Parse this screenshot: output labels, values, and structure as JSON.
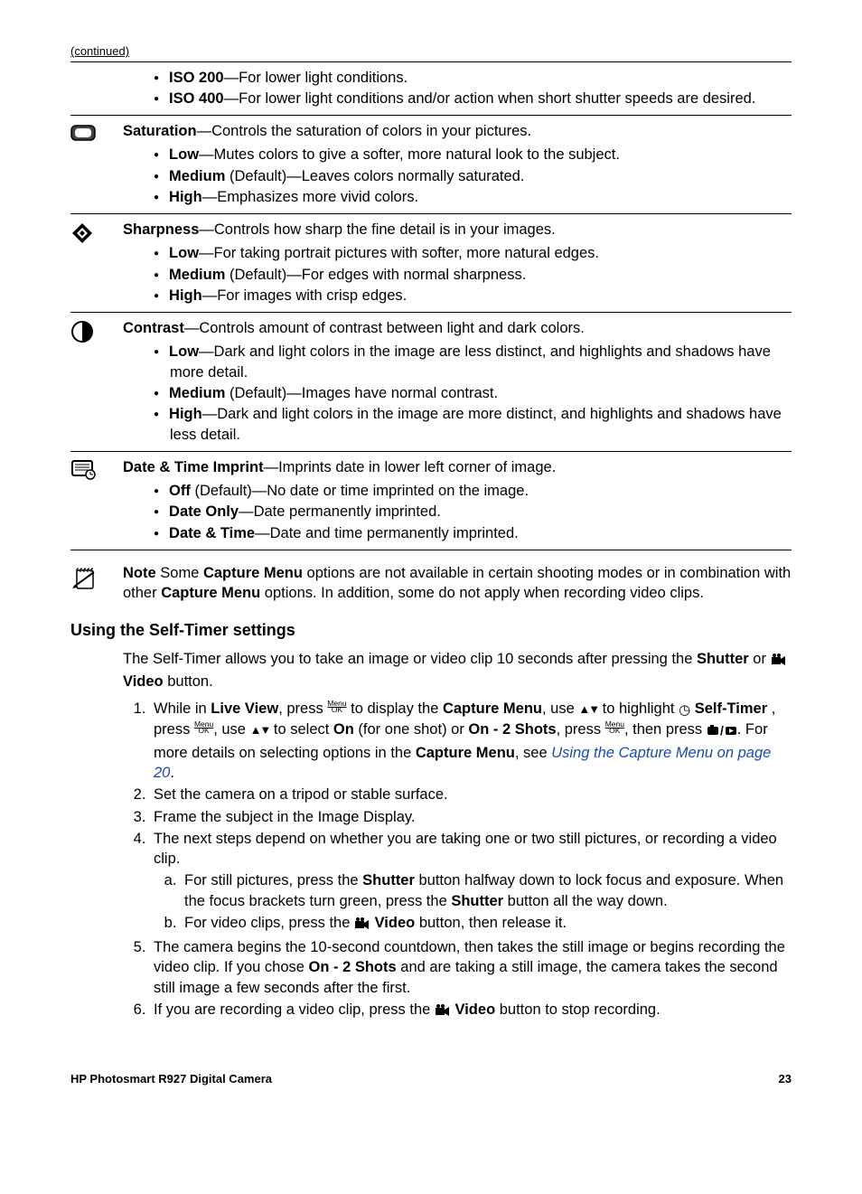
{
  "continued": "(continued)",
  "row_iso": {
    "items": [
      {
        "b1": "ISO 200",
        "t1": "—For lower light conditions."
      },
      {
        "b1": "ISO 400",
        "t1": "—For lower light conditions and/or action when short shutter speeds are desired."
      }
    ]
  },
  "row_saturation": {
    "intro_b": "Saturation",
    "intro_t": "—Controls the saturation of colors in your pictures.",
    "items": [
      {
        "b1": "Low",
        "t1": "—Mutes colors to give a softer, more natural look to the subject."
      },
      {
        "b1": "Medium",
        "t1": " (Default)—Leaves colors normally saturated."
      },
      {
        "b1": "High",
        "t1": "—Emphasizes more vivid colors."
      }
    ]
  },
  "row_sharpness": {
    "intro_b": "Sharpness",
    "intro_t": "—Controls how sharp the fine detail is in your images.",
    "items": [
      {
        "b1": "Low",
        "t1": "—For taking portrait pictures with softer, more natural edges."
      },
      {
        "b1": "Medium",
        "t1": " (Default)—For edges with normal sharpness."
      },
      {
        "b1": "High",
        "t1": "—For images with crisp edges."
      }
    ]
  },
  "row_contrast": {
    "intro_b": "Contrast",
    "intro_t": "—Controls amount of contrast between light and dark colors.",
    "items": [
      {
        "b1": "Low",
        "t1": "—Dark and light colors in the image are less distinct, and highlights and shadows have more detail."
      },
      {
        "b1": "Medium",
        "t1": " (Default)—Images have normal contrast."
      },
      {
        "b1": "High",
        "t1": "—Dark and light colors in the image are more distinct, and highlights and shadows have less detail."
      }
    ]
  },
  "row_date": {
    "intro_b": "Date & Time Imprint",
    "intro_t": "—Imprints date in lower left corner of image.",
    "items": [
      {
        "b1": "Off",
        "t1": " (Default)—No date or time imprinted on the image."
      },
      {
        "b1": "Date Only",
        "t1": "—Date permanently imprinted."
      },
      {
        "b1": "Date & Time",
        "t1": "—Date and time permanently imprinted."
      }
    ]
  },
  "note": {
    "label": "Note",
    "t1": " Some ",
    "b1": "Capture Menu",
    "t2": " options are not available in certain shooting modes or in combination with other ",
    "b2": "Capture Menu",
    "t3": " options. In addition, some do not apply when recording video clips."
  },
  "heading": "Using the Self-Timer settings",
  "intro": {
    "t1": "The Self-Timer allows you to take an image or video clip 10 seconds after pressing the ",
    "b1": "Shutter",
    "t2": " or ",
    "b2": "Video",
    "t3": " button."
  },
  "step1": {
    "t1": "While in ",
    "b1": "Live View",
    "t2": ", press ",
    "t3": " to display the ",
    "b3": "Capture Menu",
    "t4": ", use ",
    "t5": " to highlight ",
    "b5": "Self-Timer",
    "t6": " , press ",
    "t7": ", use ",
    "t8": " to select ",
    "b8a": "On",
    "t8a": " (for one shot) or ",
    "b8b": "On - 2 Shots",
    "t8b": ", press ",
    "t9": ", then press ",
    "t10": ". For more details on selecting options in the ",
    "b10": "Capture Menu",
    "t11": ", see ",
    "link": "Using the Capture Menu",
    "linkpage": " on page 20",
    "dot": "."
  },
  "step2": "Set the camera on a tripod or stable surface.",
  "step3": "Frame the subject in the Image Display.",
  "step4": {
    "intro": "The next steps depend on whether you are taking one or two still pictures, or recording a video clip.",
    "a": {
      "t1": "For still pictures, press the ",
      "b1": "Shutter",
      "t2": " button halfway down to lock focus and exposure. When the focus brackets turn green, press the ",
      "b2": "Shutter",
      "t3": " button all the way down."
    },
    "b": {
      "t1": "For video clips, press the ",
      "b1": "Video",
      "t2": " button, then release it."
    }
  },
  "step5": {
    "t1": "The camera begins the 10-second countdown, then takes the still image or begins recording the video clip. If you chose ",
    "b1": "On - 2 Shots",
    "t2": " and are taking a still image, the camera takes the second still image a few seconds after the first."
  },
  "step6": {
    "t1": "If you are recording a video clip, press the ",
    "b1": "Video",
    "t2": " button to stop recording."
  },
  "footer_left": "HP Photosmart R927 Digital Camera",
  "footer_right": "23",
  "menu_label": "Menu",
  "ok_label": "OK"
}
